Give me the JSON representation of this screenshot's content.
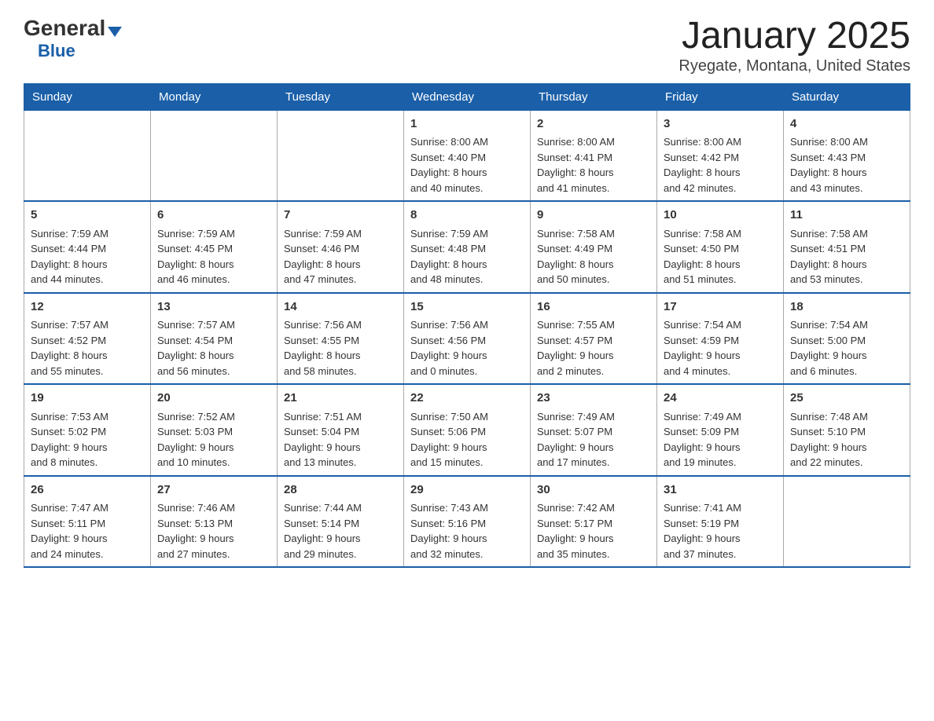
{
  "logo": {
    "general": "General",
    "blue": "Blue",
    "triangle": "▲"
  },
  "title": "January 2025",
  "subtitle": "Ryegate, Montana, United States",
  "weekdays": [
    "Sunday",
    "Monday",
    "Tuesday",
    "Wednesday",
    "Thursday",
    "Friday",
    "Saturday"
  ],
  "weeks": [
    [
      {
        "day": "",
        "info": ""
      },
      {
        "day": "",
        "info": ""
      },
      {
        "day": "",
        "info": ""
      },
      {
        "day": "1",
        "info": "Sunrise: 8:00 AM\nSunset: 4:40 PM\nDaylight: 8 hours\nand 40 minutes."
      },
      {
        "day": "2",
        "info": "Sunrise: 8:00 AM\nSunset: 4:41 PM\nDaylight: 8 hours\nand 41 minutes."
      },
      {
        "day": "3",
        "info": "Sunrise: 8:00 AM\nSunset: 4:42 PM\nDaylight: 8 hours\nand 42 minutes."
      },
      {
        "day": "4",
        "info": "Sunrise: 8:00 AM\nSunset: 4:43 PM\nDaylight: 8 hours\nand 43 minutes."
      }
    ],
    [
      {
        "day": "5",
        "info": "Sunrise: 7:59 AM\nSunset: 4:44 PM\nDaylight: 8 hours\nand 44 minutes."
      },
      {
        "day": "6",
        "info": "Sunrise: 7:59 AM\nSunset: 4:45 PM\nDaylight: 8 hours\nand 46 minutes."
      },
      {
        "day": "7",
        "info": "Sunrise: 7:59 AM\nSunset: 4:46 PM\nDaylight: 8 hours\nand 47 minutes."
      },
      {
        "day": "8",
        "info": "Sunrise: 7:59 AM\nSunset: 4:48 PM\nDaylight: 8 hours\nand 48 minutes."
      },
      {
        "day": "9",
        "info": "Sunrise: 7:58 AM\nSunset: 4:49 PM\nDaylight: 8 hours\nand 50 minutes."
      },
      {
        "day": "10",
        "info": "Sunrise: 7:58 AM\nSunset: 4:50 PM\nDaylight: 8 hours\nand 51 minutes."
      },
      {
        "day": "11",
        "info": "Sunrise: 7:58 AM\nSunset: 4:51 PM\nDaylight: 8 hours\nand 53 minutes."
      }
    ],
    [
      {
        "day": "12",
        "info": "Sunrise: 7:57 AM\nSunset: 4:52 PM\nDaylight: 8 hours\nand 55 minutes."
      },
      {
        "day": "13",
        "info": "Sunrise: 7:57 AM\nSunset: 4:54 PM\nDaylight: 8 hours\nand 56 minutes."
      },
      {
        "day": "14",
        "info": "Sunrise: 7:56 AM\nSunset: 4:55 PM\nDaylight: 8 hours\nand 58 minutes."
      },
      {
        "day": "15",
        "info": "Sunrise: 7:56 AM\nSunset: 4:56 PM\nDaylight: 9 hours\nand 0 minutes."
      },
      {
        "day": "16",
        "info": "Sunrise: 7:55 AM\nSunset: 4:57 PM\nDaylight: 9 hours\nand 2 minutes."
      },
      {
        "day": "17",
        "info": "Sunrise: 7:54 AM\nSunset: 4:59 PM\nDaylight: 9 hours\nand 4 minutes."
      },
      {
        "day": "18",
        "info": "Sunrise: 7:54 AM\nSunset: 5:00 PM\nDaylight: 9 hours\nand 6 minutes."
      }
    ],
    [
      {
        "day": "19",
        "info": "Sunrise: 7:53 AM\nSunset: 5:02 PM\nDaylight: 9 hours\nand 8 minutes."
      },
      {
        "day": "20",
        "info": "Sunrise: 7:52 AM\nSunset: 5:03 PM\nDaylight: 9 hours\nand 10 minutes."
      },
      {
        "day": "21",
        "info": "Sunrise: 7:51 AM\nSunset: 5:04 PM\nDaylight: 9 hours\nand 13 minutes."
      },
      {
        "day": "22",
        "info": "Sunrise: 7:50 AM\nSunset: 5:06 PM\nDaylight: 9 hours\nand 15 minutes."
      },
      {
        "day": "23",
        "info": "Sunrise: 7:49 AM\nSunset: 5:07 PM\nDaylight: 9 hours\nand 17 minutes."
      },
      {
        "day": "24",
        "info": "Sunrise: 7:49 AM\nSunset: 5:09 PM\nDaylight: 9 hours\nand 19 minutes."
      },
      {
        "day": "25",
        "info": "Sunrise: 7:48 AM\nSunset: 5:10 PM\nDaylight: 9 hours\nand 22 minutes."
      }
    ],
    [
      {
        "day": "26",
        "info": "Sunrise: 7:47 AM\nSunset: 5:11 PM\nDaylight: 9 hours\nand 24 minutes."
      },
      {
        "day": "27",
        "info": "Sunrise: 7:46 AM\nSunset: 5:13 PM\nDaylight: 9 hours\nand 27 minutes."
      },
      {
        "day": "28",
        "info": "Sunrise: 7:44 AM\nSunset: 5:14 PM\nDaylight: 9 hours\nand 29 minutes."
      },
      {
        "day": "29",
        "info": "Sunrise: 7:43 AM\nSunset: 5:16 PM\nDaylight: 9 hours\nand 32 minutes."
      },
      {
        "day": "30",
        "info": "Sunrise: 7:42 AM\nSunset: 5:17 PM\nDaylight: 9 hours\nand 35 minutes."
      },
      {
        "day": "31",
        "info": "Sunrise: 7:41 AM\nSunset: 5:19 PM\nDaylight: 9 hours\nand 37 minutes."
      },
      {
        "day": "",
        "info": ""
      }
    ]
  ]
}
